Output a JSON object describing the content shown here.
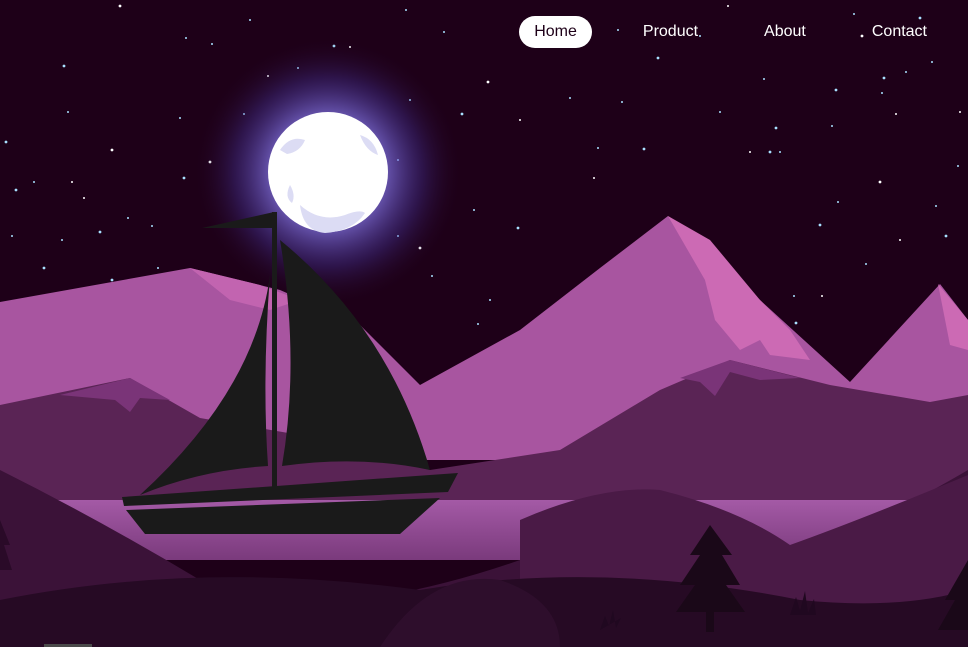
{
  "nav": {
    "items": [
      {
        "label": "Home",
        "active": true
      },
      {
        "label": "Product",
        "active": false
      },
      {
        "label": "About",
        "active": false
      },
      {
        "label": "Contact",
        "active": false
      }
    ]
  },
  "colors": {
    "sky": "#1e0018",
    "mountain_light": "#a855a0",
    "mountain_highlight": "#cc6ab4",
    "mountain_mid": "#5a2455",
    "water": "#a054a0",
    "foreground": "#2a0a28",
    "boat": "#1a1a1a",
    "moon": "#ffffff",
    "moon_glow": "#6a5cd8",
    "star": "#a8e0ff"
  },
  "icons": {
    "moon": "moon-icon",
    "boat": "sailboat-icon",
    "tree": "pine-tree-icon"
  }
}
